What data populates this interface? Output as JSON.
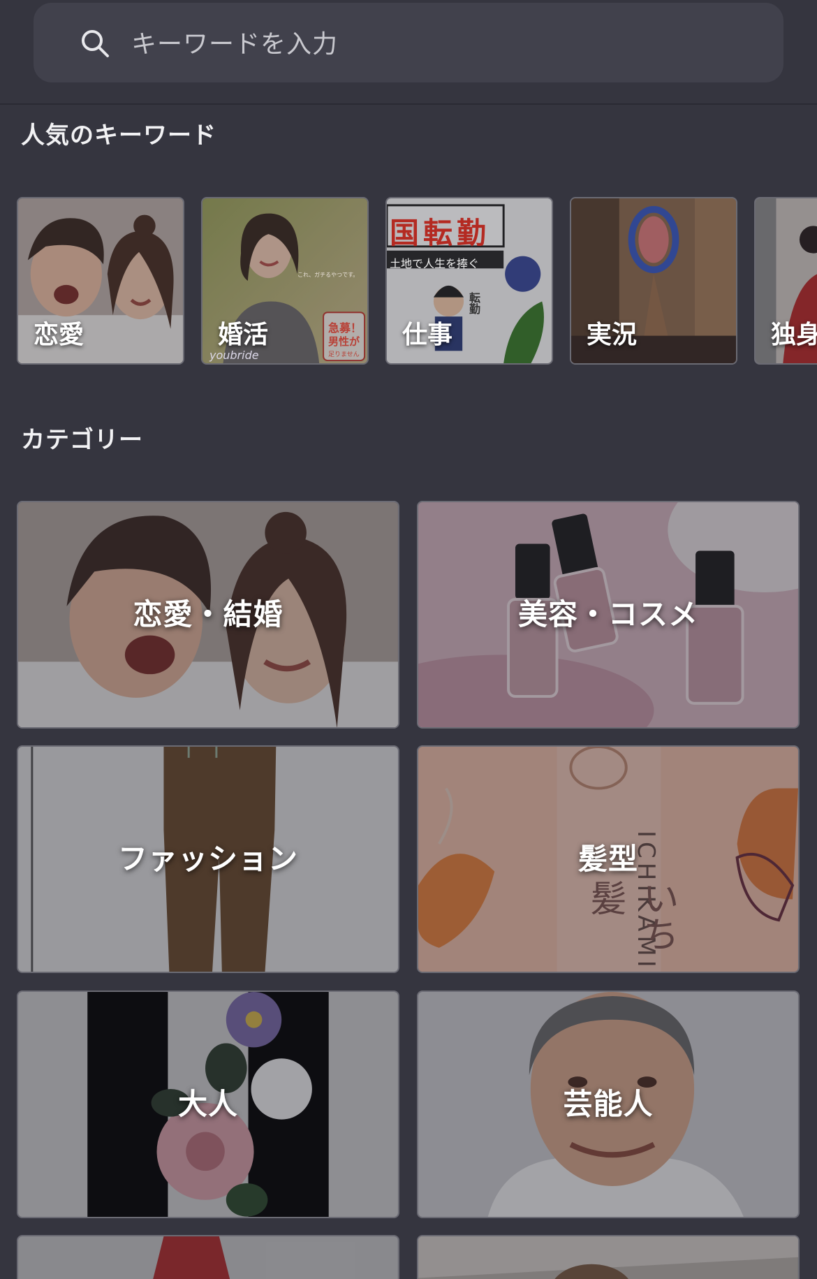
{
  "search": {
    "placeholder": "キーワードを入力"
  },
  "popular": {
    "title": "人気のキーワード",
    "keywords": [
      {
        "label": "恋愛"
      },
      {
        "label": "婚活"
      },
      {
        "label": "仕事"
      },
      {
        "label": "実況"
      },
      {
        "label": "独身"
      }
    ],
    "tile_texts": {
      "kekkon_caption": "これ、ガチるやつです。",
      "kekkon_badge_1": "急募！",
      "kekkon_badge_2": "男性が",
      "kekkon_badge_3": "足りません",
      "kekkon_logo": "youbride",
      "shigoto_header": "国転勤",
      "shigoto_sub": "土地で人生を捧ぐ",
      "shigoto_sign": "転勤"
    }
  },
  "category": {
    "title": "カテゴリー",
    "items": [
      {
        "label": "恋愛・結婚"
      },
      {
        "label": "美容・コスメ"
      },
      {
        "label": "ファッション"
      },
      {
        "label": "髪型"
      },
      {
        "label": "大人"
      },
      {
        "label": "芸能人"
      }
    ],
    "tile_texts": {
      "hair_vertical": "ICHIKAMI",
      "hair_kana": "いち髪"
    }
  }
}
